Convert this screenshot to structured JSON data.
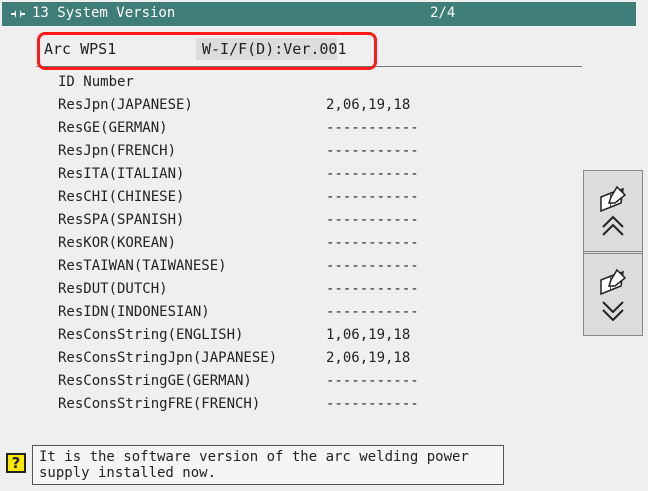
{
  "titlebar": {
    "title": "13 System Version",
    "page": "2/4"
  },
  "header": {
    "name": "Arc WPS1",
    "version": "W-I/F(D):Ver.001"
  },
  "rows": [
    {
      "name": "ID Number",
      "value": ""
    },
    {
      "name": "ResJpn(JAPANESE)",
      "value": "2,06,19,18"
    },
    {
      "name": "ResGE(GERMAN)",
      "value": "-----------"
    },
    {
      "name": "ResJpn(FRENCH)",
      "value": "-----------"
    },
    {
      "name": "ResITA(ITALIAN)",
      "value": "-----------"
    },
    {
      "name": "ResCHI(CHINESE)",
      "value": "-----------"
    },
    {
      "name": "ResSPA(SPANISH)",
      "value": "-----------"
    },
    {
      "name": "ResKOR(KOREAN)",
      "value": "-----------"
    },
    {
      "name": "ResTAIWAN(TAIWANESE)",
      "value": "-----------"
    },
    {
      "name": "ResDUT(DUTCH)",
      "value": "-----------"
    },
    {
      "name": "ResIDN(INDONESIAN)",
      "value": "-----------"
    },
    {
      "name": "ResConsString(ENGLISH)",
      "value": "1,06,19,18"
    },
    {
      "name": "ResConsStringJpn(JAPANESE)",
      "value": "2,06,19,18"
    },
    {
      "name": "ResConsStringGE(GERMAN)",
      "value": "-----------"
    },
    {
      "name": "ResConsStringFRE(FRENCH)",
      "value": "-----------"
    }
  ],
  "help": {
    "text": "It is the software version of the arc welding power\nsupply installed now."
  },
  "icons": {
    "logo": "plug-icon",
    "page_up": "page-up-icon",
    "page_down": "page-down-icon",
    "help": "question-icon"
  },
  "colors": {
    "titlebar": "#3f7d78",
    "highlight": "#ff1a1a",
    "help_icon": "#ffe800"
  }
}
